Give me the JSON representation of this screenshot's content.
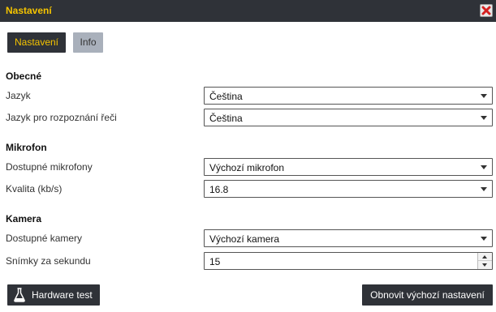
{
  "window": {
    "title": "Nastavení"
  },
  "tabs": [
    {
      "label": "Nastavení",
      "active": true
    },
    {
      "label": "Info",
      "active": false
    }
  ],
  "sections": {
    "general": {
      "title": "Obecné",
      "language_label": "Jazyk",
      "language_value": "Čeština",
      "speech_language_label": "Jazyk pro rozpoznání řeči",
      "speech_language_value": "Čeština"
    },
    "microphone": {
      "title": "Mikrofon",
      "devices_label": "Dostupné mikrofony",
      "devices_value": "Výchozí mikrofon",
      "quality_label": "Kvalita (kb/s)",
      "quality_value": "16.8"
    },
    "camera": {
      "title": "Kamera",
      "devices_label": "Dostupné kamery",
      "devices_value": "Výchozí kamera",
      "fps_label": "Snímky za sekundu",
      "fps_value": "15"
    }
  },
  "footer": {
    "hardware_test_label": "Hardware test",
    "reset_label": "Obnovit výchozí nastavení"
  },
  "colors": {
    "titlebar_bg": "#2f3238",
    "accent": "#f5c400",
    "inactive_tab": "#a9b0bb",
    "close_icon": "#d42020"
  }
}
